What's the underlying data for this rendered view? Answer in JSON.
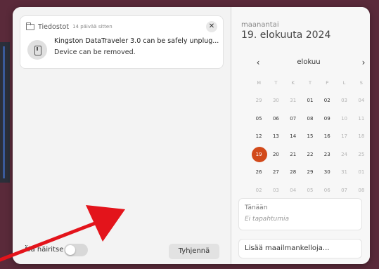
{
  "notification": {
    "app_name": "Tiedostot",
    "time": "14 päivää sitten",
    "title": "Kingston DataTraveler 3.0 can be safely unplug...",
    "body": "Device can be removed.",
    "close_symbol": "✕",
    "app_icon": "folder-icon",
    "device_icon": "usb-drive-icon"
  },
  "controls": {
    "dnd_label": "Älä häiritse",
    "dnd_enabled": false,
    "clear_label": "Tyhjennä"
  },
  "calendar": {
    "weekday": "maanantai",
    "date": "19. elokuuta 2024",
    "month": "elokuu",
    "prev_symbol": "‹",
    "next_symbol": "›",
    "headers": [
      "M",
      "T",
      "K",
      "T",
      "P",
      "L",
      "S"
    ],
    "weeks": [
      [
        {
          "d": "29",
          "dim": true
        },
        {
          "d": "30",
          "dim": true
        },
        {
          "d": "31",
          "dim": true
        },
        {
          "d": "01"
        },
        {
          "d": "02"
        },
        {
          "d": "03",
          "dim": true
        },
        {
          "d": "04",
          "dim": true
        }
      ],
      [
        {
          "d": "05"
        },
        {
          "d": "06"
        },
        {
          "d": "07"
        },
        {
          "d": "08"
        },
        {
          "d": "09"
        },
        {
          "d": "10",
          "dim": true
        },
        {
          "d": "11",
          "dim": true
        }
      ],
      [
        {
          "d": "12"
        },
        {
          "d": "13"
        },
        {
          "d": "14"
        },
        {
          "d": "15"
        },
        {
          "d": "16"
        },
        {
          "d": "17",
          "dim": true
        },
        {
          "d": "18",
          "dim": true
        }
      ],
      [
        {
          "d": "19",
          "today": true
        },
        {
          "d": "20"
        },
        {
          "d": "21"
        },
        {
          "d": "22"
        },
        {
          "d": "23"
        },
        {
          "d": "24",
          "dim": true
        },
        {
          "d": "25",
          "dim": true
        }
      ],
      [
        {
          "d": "26"
        },
        {
          "d": "27"
        },
        {
          "d": "28"
        },
        {
          "d": "29"
        },
        {
          "d": "30"
        },
        {
          "d": "31",
          "dim": true
        },
        {
          "d": "01",
          "dim": true
        }
      ],
      [
        {
          "d": "02",
          "dim": true
        },
        {
          "d": "03",
          "dim": true
        },
        {
          "d": "04",
          "dim": true
        },
        {
          "d": "05",
          "dim": true
        },
        {
          "d": "06",
          "dim": true
        },
        {
          "d": "07",
          "dim": true
        },
        {
          "d": "08",
          "dim": true
        }
      ]
    ],
    "today_color": "#d24a1b"
  },
  "events": {
    "title": "Tänään",
    "empty": "Ei tapahtumia"
  },
  "world_clocks": {
    "label": "Lisää maailmankelloja..."
  }
}
